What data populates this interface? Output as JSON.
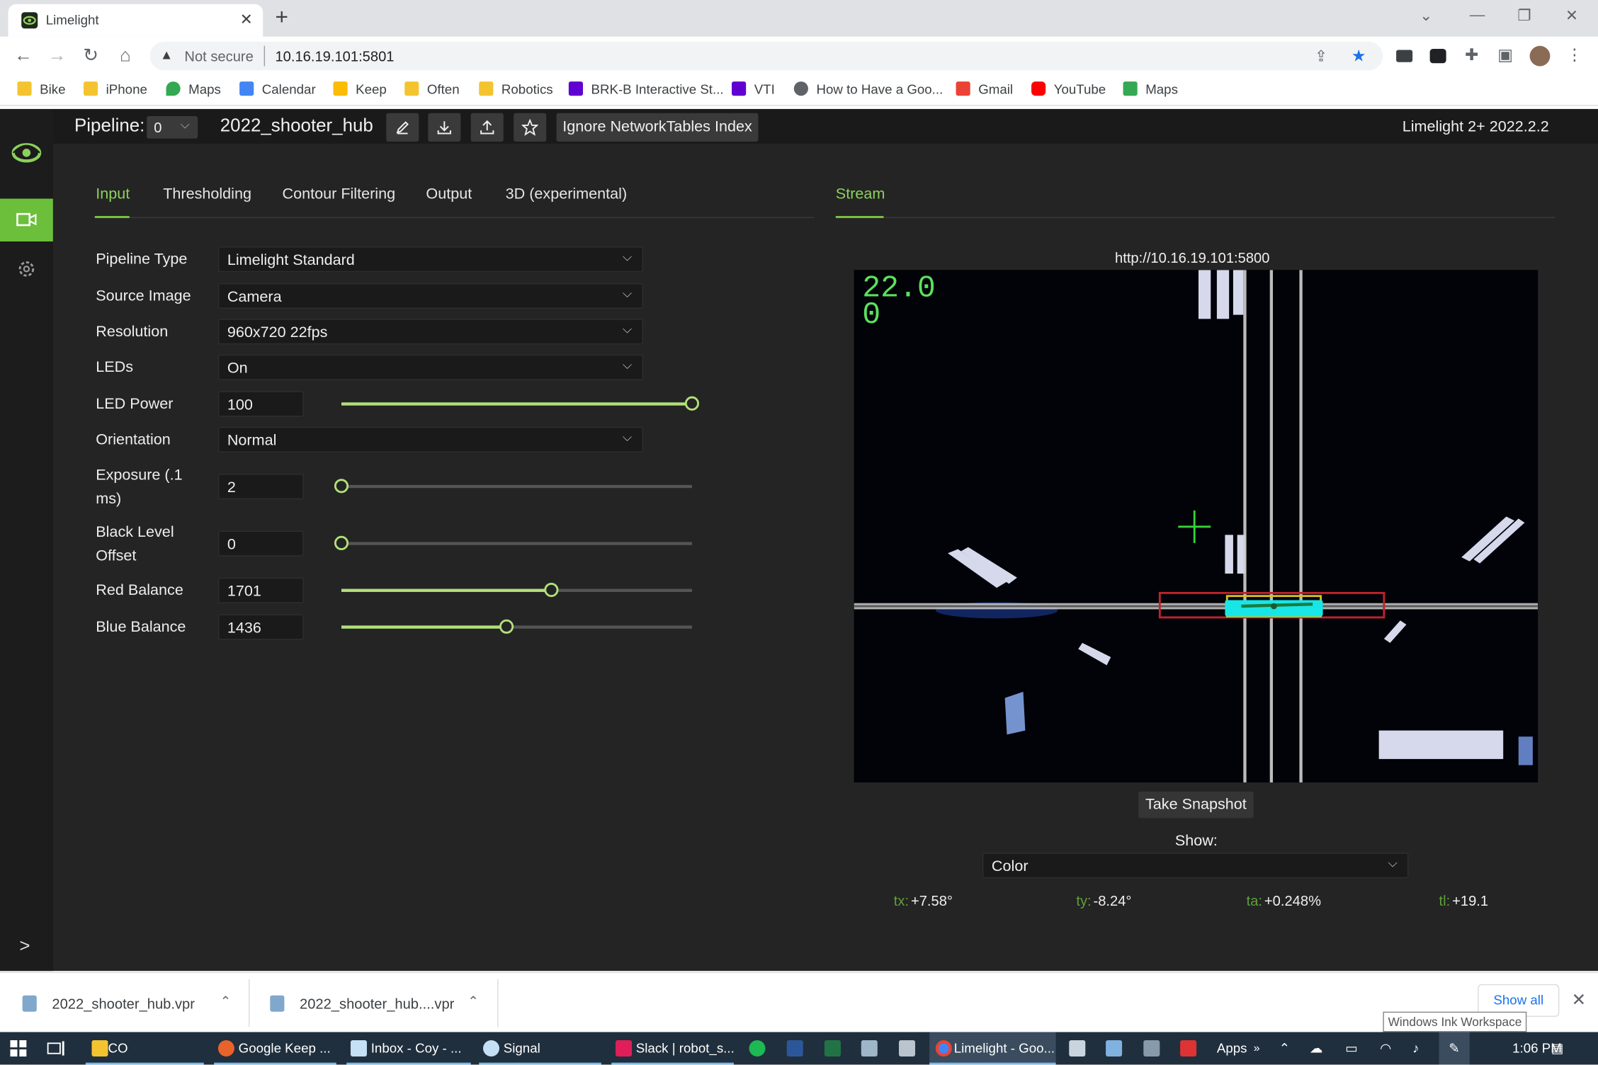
{
  "browser": {
    "tab_title": "Limelight",
    "new_tab": "+",
    "close": "✕",
    "security_label": "Not secure",
    "url": "10.16.19.101:5801",
    "bookmarks": [
      "Bike",
      "iPhone",
      "Maps",
      "Calendar",
      "Keep",
      "Often",
      "Robotics",
      "BRK-B Interactive St...",
      "VTI",
      "How to Have a Goo...",
      "Gmail",
      "YouTube",
      "Maps"
    ]
  },
  "app": {
    "pipeline_label": "Pipeline:",
    "pipeline_index": "0",
    "pipeline_name": "2022_shooter_hub",
    "ignore_nt_button": "Ignore NetworkTables Index",
    "version": "Limelight 2+ 2022.2.2",
    "tabs": [
      "Input",
      "Thresholding",
      "Contour Filtering",
      "Output",
      "3D (experimental)"
    ],
    "stream_tab": "Stream",
    "fields": {
      "pipeline_type": {
        "label": "Pipeline Type",
        "value": "Limelight Standard"
      },
      "source_image": {
        "label": "Source Image",
        "value": "Camera"
      },
      "resolution": {
        "label": "Resolution",
        "value": "960x720 22fps"
      },
      "leds": {
        "label": "LEDs",
        "value": "On"
      },
      "led_power": {
        "label": "LED Power",
        "value": "100",
        "fraction": 1.0
      },
      "orientation": {
        "label": "Orientation",
        "value": "Normal"
      },
      "exposure": {
        "label_1": "Exposure (.1",
        "label_2": "ms)",
        "value": "2",
        "fraction": 0.0
      },
      "black_level": {
        "label_1": "Black Level",
        "label_2": "Offset",
        "value": "0",
        "fraction": 0.0
      },
      "red_balance": {
        "label": "Red Balance",
        "value": "1701",
        "fraction": 0.6
      },
      "blue_balance": {
        "label": "Blue Balance",
        "value": "1436",
        "fraction": 0.47
      }
    },
    "stream": {
      "url": "http://10.16.19.101:5800",
      "overlay_line1": "22.0",
      "overlay_line2": "0",
      "snapshot_button": "Take Snapshot",
      "show_label": "Show:",
      "show_value": "Color"
    },
    "targets": {
      "tx": {
        "key": "tx:",
        "value": "+7.58°"
      },
      "ty": {
        "key": "ty:",
        "value": "-8.24°"
      },
      "ta": {
        "key": "ta:",
        "value": "+0.248%"
      },
      "tl": {
        "key": "tl:",
        "value": "+19.1"
      }
    }
  },
  "downloads": {
    "items": [
      "2022_shooter_hub.vpr",
      "2022_shooter_hub....vpr"
    ],
    "show_all": "Show all",
    "tooltip": "Windows Ink Workspace"
  },
  "taskbar": {
    "items": [
      "CO",
      "Google Keep ...",
      "Inbox - Coy - ...",
      "Signal",
      "Slack | robot_s...",
      "Limelight - Goo..."
    ],
    "apps_label": "Apps",
    "time": "1:06 PM"
  },
  "colors": {
    "accent": "#8cd15c",
    "panel": "#242424",
    "target_cyan": "#18e6e6"
  },
  "icons": [
    "limelight-logo-icon",
    "camera-icon",
    "gear-icon",
    "chevron-right-icon",
    "edit-icon",
    "download-icon",
    "upload-icon",
    "star-icon"
  ]
}
